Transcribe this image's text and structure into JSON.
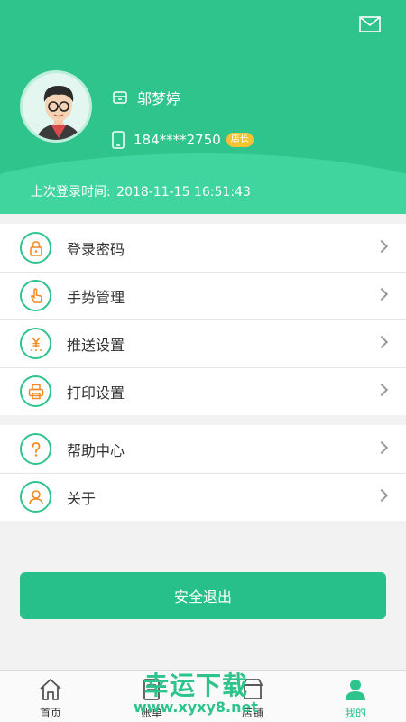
{
  "profile": {
    "name": "邬梦婷",
    "phone": "184****2750",
    "role_badge": "店长",
    "last_login_label": "上次登录时间:",
    "last_login_time": "2018-11-15 16:51:43"
  },
  "menu_group_1": [
    {
      "label": "登录密码",
      "icon": "lock-icon"
    },
    {
      "label": "手势管理",
      "icon": "hand-gesture-icon"
    },
    {
      "label": "推送设置",
      "icon": "yen-push-icon"
    },
    {
      "label": "打印设置",
      "icon": "printer-icon"
    }
  ],
  "menu_group_2": [
    {
      "label": "帮助中心",
      "icon": "question-icon"
    },
    {
      "label": "关于",
      "icon": "person-icon"
    }
  ],
  "logout_label": "安全退出",
  "tabs": [
    {
      "label": "首页",
      "icon": "home-icon"
    },
    {
      "label": "账单",
      "icon": "bill-icon"
    },
    {
      "label": "店铺",
      "icon": "shop-icon"
    },
    {
      "label": "我的",
      "icon": "user-icon"
    }
  ],
  "watermark": {
    "text": "幸运下载",
    "url": "www.xyxy8.net"
  },
  "colors": {
    "primary": "#2ec48c",
    "accent_orange": "#f08a24",
    "badge": "#f5c233"
  }
}
